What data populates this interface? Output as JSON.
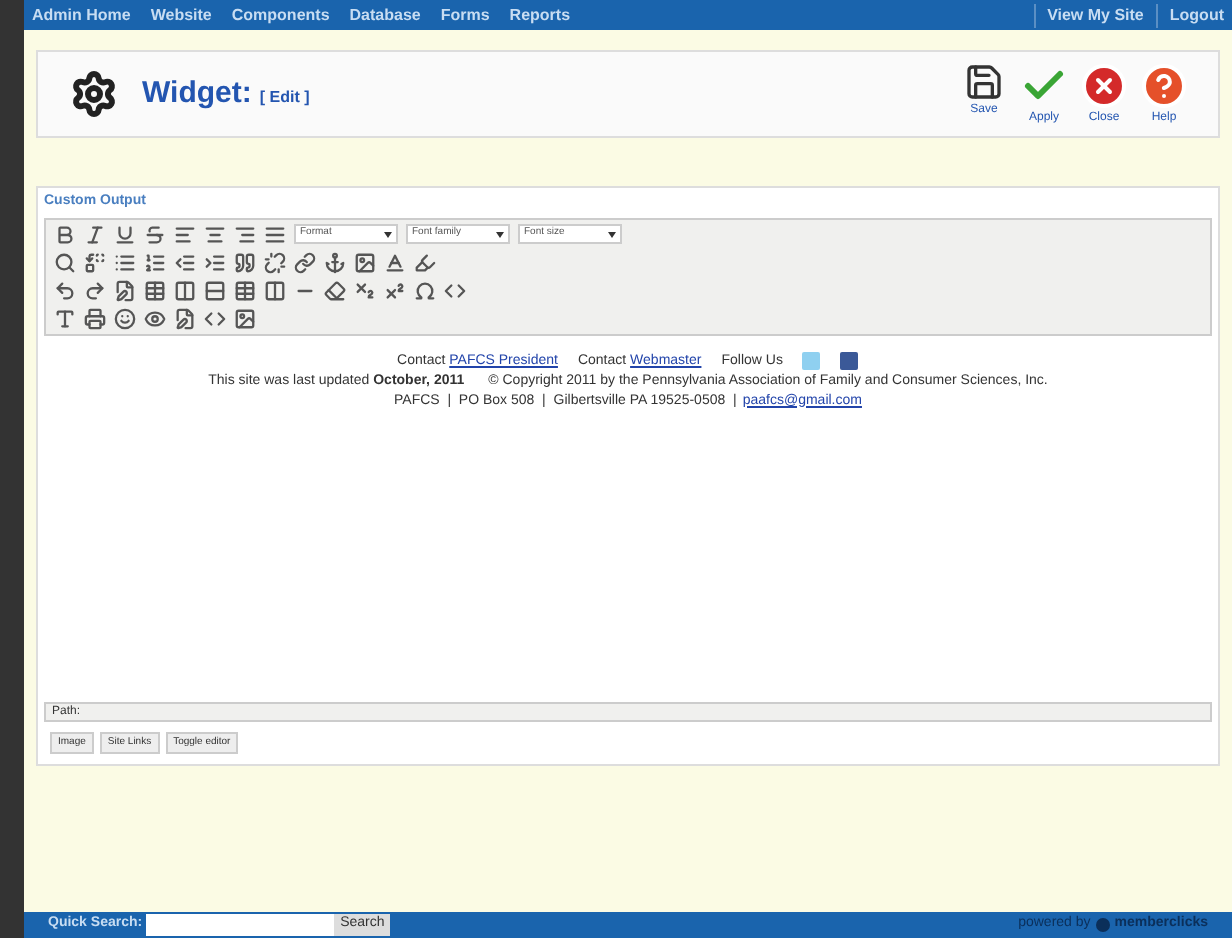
{
  "nav": {
    "left": [
      "Admin Home",
      "Website",
      "Components",
      "Database",
      "Forms",
      "Reports"
    ],
    "right": [
      "View My Site",
      "Logout"
    ]
  },
  "header": {
    "title": "Widget:",
    "edit": "[ Edit ]",
    "actions": [
      {
        "kind": "save",
        "label": "Save"
      },
      {
        "kind": "apply",
        "label": "Apply"
      },
      {
        "kind": "close",
        "label": "Close"
      },
      {
        "kind": "help",
        "label": "Help"
      }
    ]
  },
  "editor": {
    "legend": "Custom Output",
    "selects": [
      "Format",
      "Font family",
      "Font size"
    ],
    "content": {
      "contact1": "Contact",
      "link1": "PAFCS President",
      "contact2": "Contact",
      "link2": "Webmaster",
      "follow": "Follow Us",
      "updated": "This site was last updated **October, 2011**",
      "copyright": "© Copyright 2011 by the Pennsylvania Association of Family and Consumer Sciences, Inc.",
      "address": "PAFCS  |  PO Box 508  |  Gilbertsville PA 19525-0508  |",
      "email": "paafcs@gmail.com"
    },
    "path": "Path:",
    "buttons": [
      "Image",
      "Site Links",
      "Toggle editor"
    ]
  },
  "footer": {
    "search_label": "Quick Search:",
    "search_button": "Search",
    "powered": "powered by",
    "brand": "memberclicks"
  }
}
